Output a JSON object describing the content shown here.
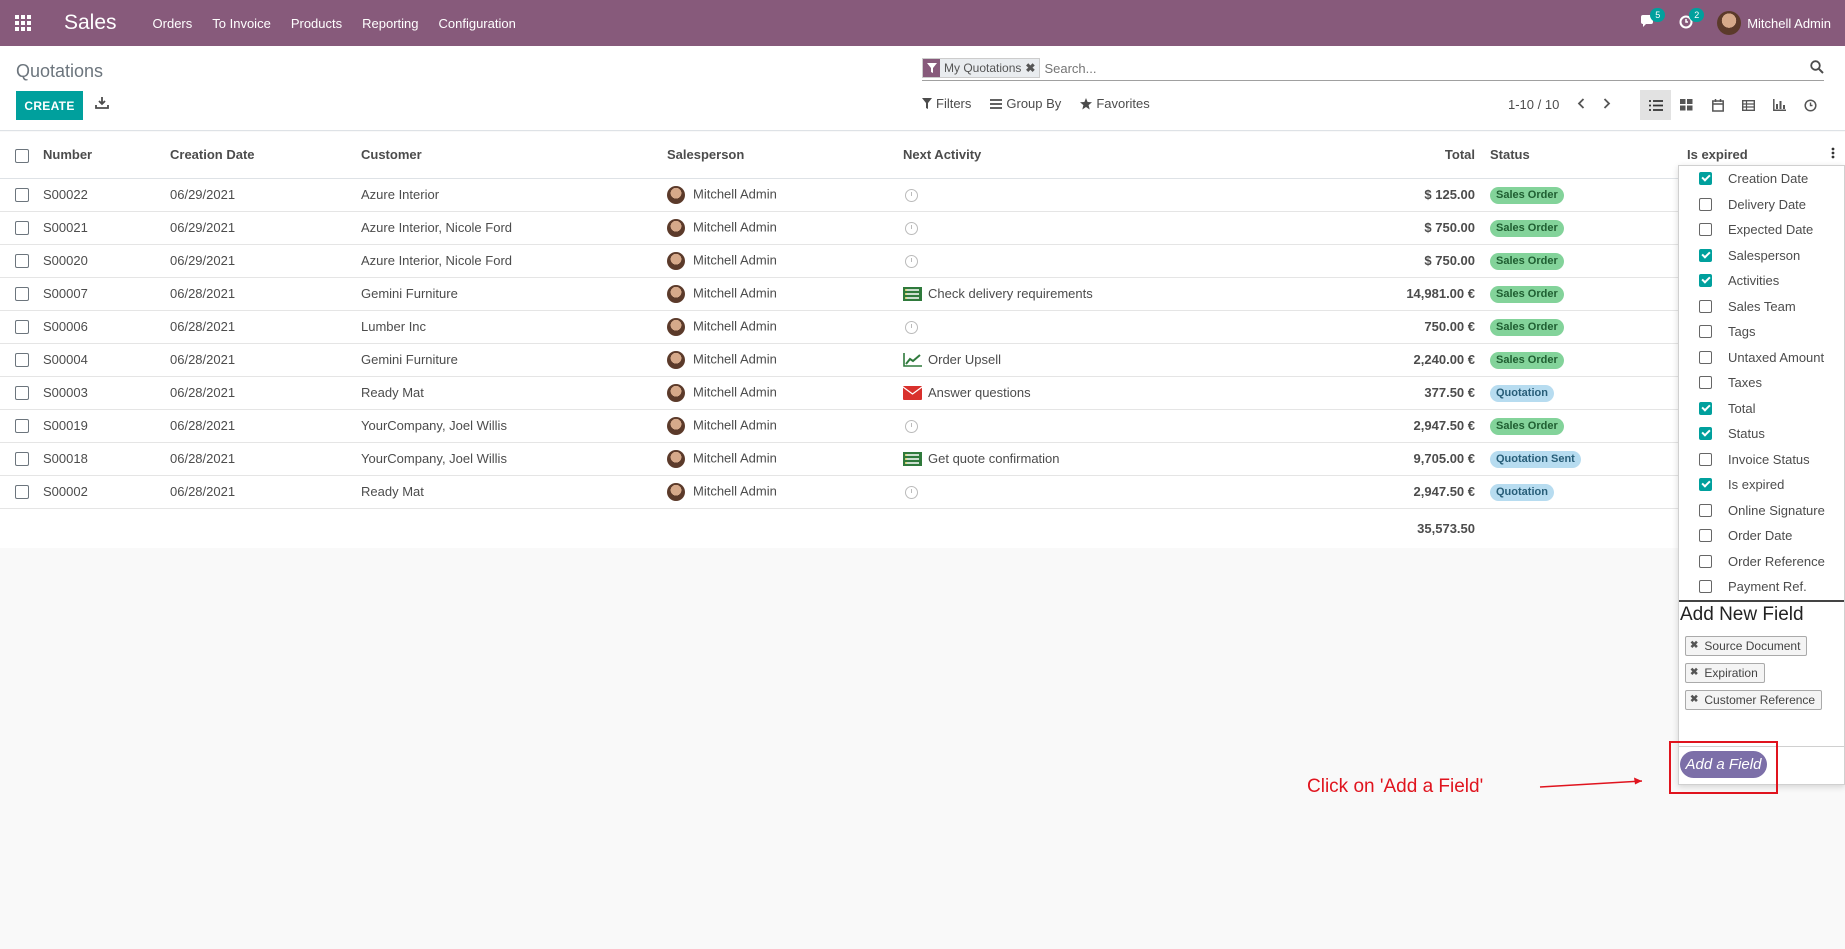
{
  "navbar": {
    "brand": "Sales",
    "menu": [
      "Orders",
      "To Invoice",
      "Products",
      "Reporting",
      "Configuration"
    ],
    "messages_count": "5",
    "activities_count": "2",
    "user_name": "Mitchell Admin"
  },
  "control_panel": {
    "breadcrumb": "Quotations",
    "create_label": "CREATE",
    "facet_label": "My Quotations",
    "search_placeholder": "Search...",
    "filters_label": "Filters",
    "group_by_label": "Group By",
    "favorites_label": "Favorites",
    "pager": "1-10 / 10"
  },
  "table": {
    "headers": {
      "number": "Number",
      "creation_date": "Creation Date",
      "customer": "Customer",
      "salesperson": "Salesperson",
      "next_activity": "Next Activity",
      "total": "Total",
      "status": "Status",
      "is_expired": "Is expired"
    },
    "rows": [
      {
        "number": "S00022",
        "date": "06/29/2021",
        "customer": "Azure Interior",
        "salesperson": "Mitchell Admin",
        "activity": "",
        "activity_icon": "clock",
        "total": "$ 125.00",
        "status": "Sales Order",
        "status_kind": "success"
      },
      {
        "number": "S00021",
        "date": "06/29/2021",
        "customer": "Azure Interior, Nicole Ford",
        "salesperson": "Mitchell Admin",
        "activity": "",
        "activity_icon": "clock",
        "total": "$ 750.00",
        "status": "Sales Order",
        "status_kind": "success"
      },
      {
        "number": "S00020",
        "date": "06/29/2021",
        "customer": "Azure Interior, Nicole Ford",
        "salesperson": "Mitchell Admin",
        "activity": "",
        "activity_icon": "clock",
        "total": "$ 750.00",
        "status": "Sales Order",
        "status_kind": "success"
      },
      {
        "number": "S00007",
        "date": "06/28/2021",
        "customer": "Gemini Furniture",
        "salesperson": "Mitchell Admin",
        "activity": "Check delivery requirements",
        "activity_icon": "tasks",
        "total": "14,981.00 €",
        "status": "Sales Order",
        "status_kind": "success"
      },
      {
        "number": "S00006",
        "date": "06/28/2021",
        "customer": "Lumber Inc",
        "salesperson": "Mitchell Admin",
        "activity": "",
        "activity_icon": "clock",
        "total": "750.00 €",
        "status": "Sales Order",
        "status_kind": "success"
      },
      {
        "number": "S00004",
        "date": "06/28/2021",
        "customer": "Gemini Furniture",
        "salesperson": "Mitchell Admin",
        "activity": "Order Upsell",
        "activity_icon": "chart",
        "total": "2,240.00 €",
        "status": "Sales Order",
        "status_kind": "success"
      },
      {
        "number": "S00003",
        "date": "06/28/2021",
        "customer": "Ready Mat",
        "salesperson": "Mitchell Admin",
        "activity": "Answer questions",
        "activity_icon": "envelope",
        "total": "377.50 €",
        "status": "Quotation",
        "status_kind": "info"
      },
      {
        "number": "S00019",
        "date": "06/28/2021",
        "customer": "YourCompany, Joel Willis",
        "salesperson": "Mitchell Admin",
        "activity": "",
        "activity_icon": "clock",
        "total": "2,947.50 €",
        "status": "Sales Order",
        "status_kind": "success"
      },
      {
        "number": "S00018",
        "date": "06/28/2021",
        "customer": "YourCompany, Joel Willis",
        "salesperson": "Mitchell Admin",
        "activity": "Get quote confirmation",
        "activity_icon": "tasks",
        "total": "9,705.00 €",
        "status": "Quotation Sent",
        "status_kind": "info"
      },
      {
        "number": "S00002",
        "date": "06/28/2021",
        "customer": "Ready Mat",
        "salesperson": "Mitchell Admin",
        "activity": "",
        "activity_icon": "clock",
        "total": "2,947.50 €",
        "status": "Quotation",
        "status_kind": "info"
      }
    ],
    "grand_total": "35,573.50"
  },
  "optional_columns": {
    "items": [
      {
        "label": "Creation Date",
        "checked": true
      },
      {
        "label": "Delivery Date",
        "checked": false
      },
      {
        "label": "Expected Date",
        "checked": false
      },
      {
        "label": "Salesperson",
        "checked": true
      },
      {
        "label": "Activities",
        "checked": true
      },
      {
        "label": "Sales Team",
        "checked": false
      },
      {
        "label": "Tags",
        "checked": false
      },
      {
        "label": "Untaxed Amount",
        "checked": false
      },
      {
        "label": "Taxes",
        "checked": false
      },
      {
        "label": "Total",
        "checked": true
      },
      {
        "label": "Status",
        "checked": true
      },
      {
        "label": "Invoice Status",
        "checked": false
      },
      {
        "label": "Is expired",
        "checked": true
      },
      {
        "label": "Online Signature",
        "checked": false
      },
      {
        "label": "Order Date",
        "checked": false
      },
      {
        "label": "Order Reference",
        "checked": false
      },
      {
        "label": "Payment Ref.",
        "checked": false
      }
    ],
    "add_new_title": "Add New Field",
    "new_fields": [
      "Source Document",
      "Expiration",
      "Customer Reference"
    ],
    "add_field_label": "Add a Field"
  },
  "annotation": {
    "text": "Click on 'Add a Field'",
    "color": "#e0141e"
  },
  "colors": {
    "brand": "#875a7b",
    "primary": "#00a09d"
  }
}
